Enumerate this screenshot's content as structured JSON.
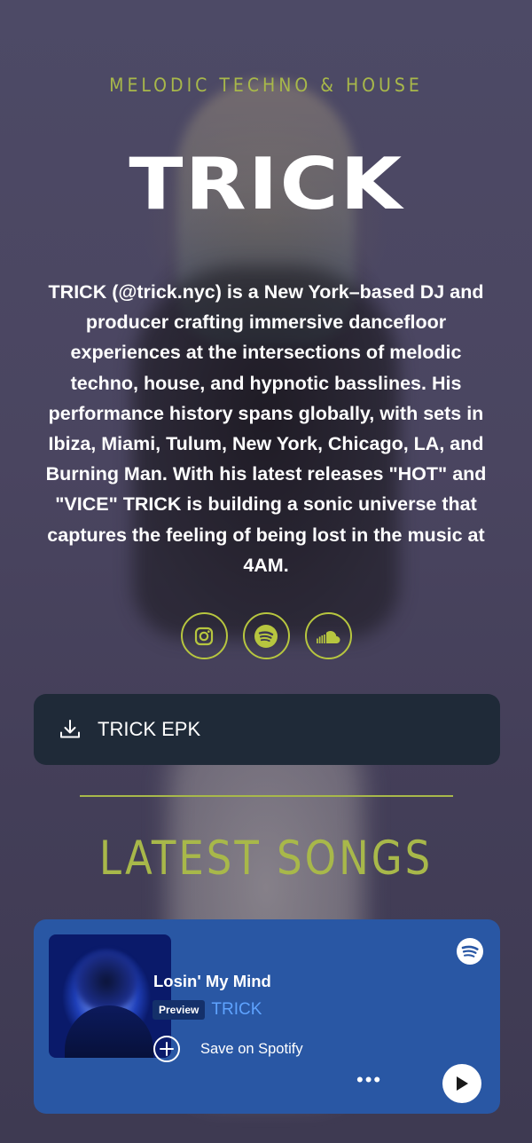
{
  "header": {
    "genre": "MELODIC TECHNO & HOUSE",
    "artist_logo": "TRICK"
  },
  "bio": "TRICK (@trick.nyc) is a New York–based DJ and producer crafting immersive dancefloor experiences at the intersections of melodic techno, house, and hypnotic basslines. His performance history spans globally, with sets in Ibiza, Miami, Tulum, New York, Chicago, LA, and Burning Man. With his latest releases \"HOT\" and \"VICE\" TRICK is building a sonic universe that captures the feeling of being lost in the music at 4AM.",
  "socials": [
    {
      "icon": "instagram-icon"
    },
    {
      "icon": "spotify-icon"
    },
    {
      "icon": "soundcloud-icon"
    }
  ],
  "epk": {
    "label": "TRICK EPK",
    "icon": "download-icon"
  },
  "latest_songs": {
    "heading": "LATEST SONGS"
  },
  "player": {
    "track_title": "Losin' My Mind",
    "badge": "Preview",
    "artist": "TRICK",
    "save_label": "Save on Spotify",
    "more_label": "•••"
  },
  "colors": {
    "accent": "#a8b84a",
    "epk_bg": "#1f2a38",
    "player_bg": "#2957a4",
    "artist_link": "#5fa3ff"
  }
}
